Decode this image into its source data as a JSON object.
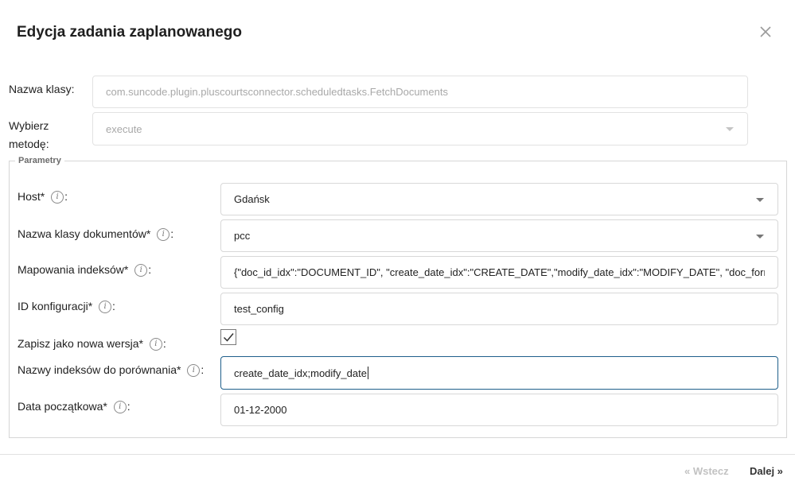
{
  "dialog": {
    "title": "Edycja zadania zaplanowanego",
    "close_icon": "close-icon"
  },
  "class_name": {
    "label": "Nazwa klasy:",
    "value": "com.suncode.plugin.pluscourtsconnector.scheduledtasks.FetchDocuments"
  },
  "method": {
    "label_line1": "Wybierz",
    "label_line2": "metodę:",
    "value": "execute"
  },
  "parameters": {
    "legend": "Parametry",
    "host": {
      "label": "Host*",
      "colon": ":",
      "value": "Gdańsk"
    },
    "doc_class": {
      "label": "Nazwa klasy dokumentów*",
      "colon": ":",
      "value": "pcc"
    },
    "index_mapping": {
      "label": "Mapowania indeksów*",
      "colon": ":",
      "value": "{\"doc_id_idx\":\"DOCUMENT_ID\", \"create_date_idx\":\"CREATE_DATE\",\"modify_date_idx\":\"MODIFY_DATE\", \"doc_format_"
    },
    "config_id": {
      "label": "ID konfiguracji*",
      "colon": ":",
      "value": "test_config"
    },
    "save_as_new_version": {
      "label": "Zapisz jako nowa wersja*",
      "colon": ":",
      "checked": true
    },
    "compare_indexes": {
      "label": "Nazwy indeksów do porównania*",
      "colon": ":",
      "value": "create_date_idx;modify_date"
    },
    "start_date": {
      "label": "Data początkowa*",
      "colon": ":",
      "value": "01-12-2000"
    },
    "info_glyph": "i"
  },
  "footer": {
    "prev_label": "« Wstecz",
    "next_label": "Dalej »"
  },
  "colors": {
    "focus_border": "#1f5f8b",
    "disabled_text": "#a8a8a8",
    "nav_disabled": "#c2c2c2"
  }
}
